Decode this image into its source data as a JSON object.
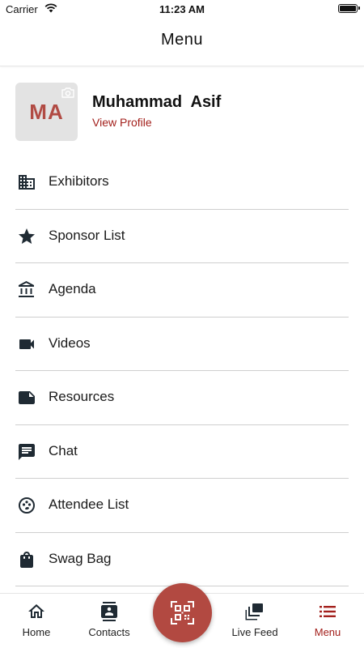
{
  "status_bar": {
    "carrier": "Carrier",
    "time": "11:23 AM"
  },
  "header": {
    "title": "Menu"
  },
  "profile": {
    "initials": "MA",
    "name": "Muhammad  Asif",
    "link": "View Profile"
  },
  "menu": {
    "items": [
      {
        "label": "Exhibitors",
        "icon": "building-icon"
      },
      {
        "label": "Sponsor List",
        "icon": "star-icon"
      },
      {
        "label": "Agenda",
        "icon": "bank-icon"
      },
      {
        "label": "Videos",
        "icon": "video-camera-icon"
      },
      {
        "label": "Resources",
        "icon": "note-icon"
      },
      {
        "label": "Chat",
        "icon": "chat-icon"
      },
      {
        "label": "Attendee List",
        "icon": "face-icon"
      },
      {
        "label": "Swag Bag",
        "icon": "shopping-bag-icon"
      }
    ]
  },
  "tab_bar": {
    "tabs": [
      {
        "label": "Home",
        "icon": "home-icon",
        "active": false
      },
      {
        "label": "Contacts",
        "icon": "contact-card-icon",
        "active": false
      },
      {
        "label": "Live Feed",
        "icon": "live-feed-icon",
        "active": false
      },
      {
        "label": "Menu",
        "icon": "list-icon",
        "active": true
      }
    ],
    "center_action": {
      "icon": "qr-scan-icon"
    }
  },
  "colors": {
    "accent": "#a3201c",
    "avatar_text": "#b14b44",
    "scan_button": "#b24941",
    "icon": "#1f2a33"
  }
}
